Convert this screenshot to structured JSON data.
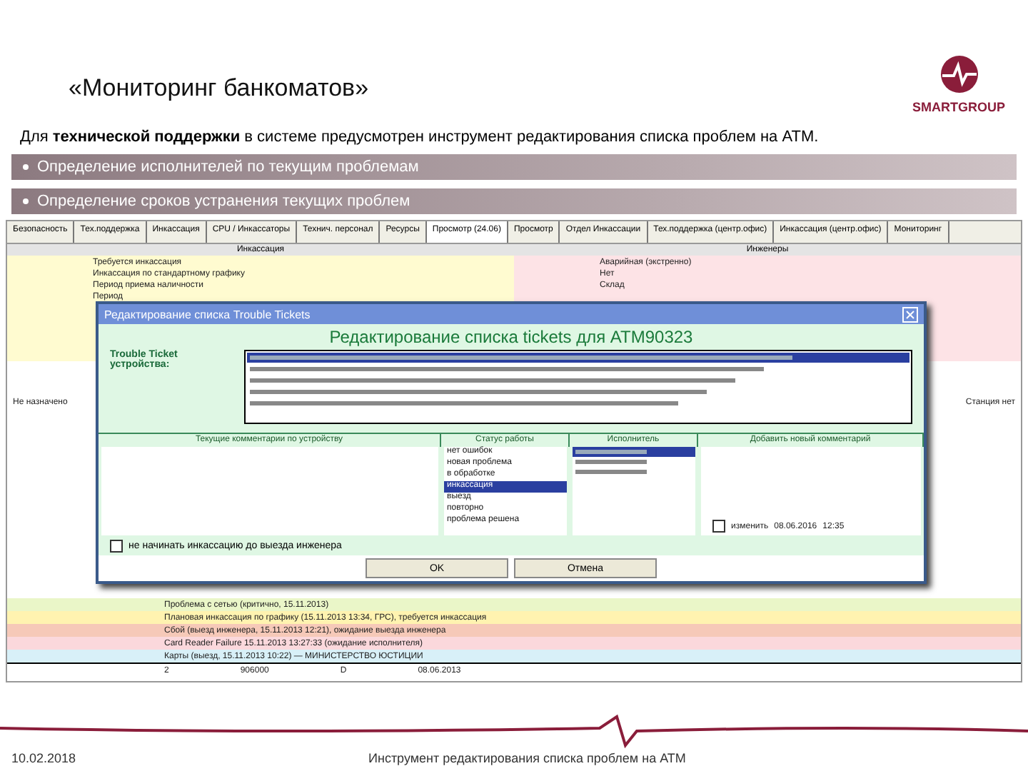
{
  "slide": {
    "title": "«Мониторинг банкоматов»",
    "logo_text": "SMARTGROUP",
    "intro": "Для **технической поддержки** в системе предусмотрен инструмент редактирования списка проблем на ATM.",
    "bullets": [
      "Определение исполнителей по текущим проблемам",
      "Определение сроков устранения текущих проблем"
    ],
    "date": "10.02.2018",
    "footer": "Инструмент редактирования списка проблем на ATM"
  },
  "app": {
    "tabs": [
      {
        "label": "Безопасность",
        "selected": false
      },
      {
        "label": "Тех.поддержка",
        "selected": false
      },
      {
        "label": "Инкассация",
        "selected": false
      },
      {
        "label": "CPU / Инкассаторы",
        "selected": false
      },
      {
        "label": "Технич. персонал",
        "selected": false
      },
      {
        "label": "Ресурсы",
        "selected": false
      },
      {
        "label": "Просмотр (24.06)",
        "selected": true
      },
      {
        "label": "Просмотр",
        "selected": false
      },
      {
        "label": "Отдел Инкассации",
        "selected": false
      },
      {
        "label": "Тех.поддержка (центр.офис)",
        "selected": false
      },
      {
        "label": "Инкассация (центр.офис)",
        "selected": false
      },
      {
        "label": "Мониторинг",
        "selected": false
      }
    ],
    "groups": [
      "Инкассация",
      "Инженеры"
    ],
    "left_rows": [
      "Требуется инкассация",
      "Инкассация по стандартному графику",
      "Период приема наличности",
      "Период"
    ],
    "right_rows": [
      "Аварийная (экстренно)",
      "Нет",
      "Склад"
    ],
    "side_label": "Не назначено",
    "side_right": "Станция нет",
    "bottom_rows": [
      {
        "color": "#eaf6c8",
        "text": "Проблема с сетью (критично, 15.11.2013)"
      },
      {
        "color": "#fff3b0",
        "text": "Плановая инкассация по графику (15.11.2013 13:34, ГРС), требуется инкассация"
      },
      {
        "color": "#f6c9b8",
        "text": "Сбой (выезд инженера, 15.11.2013 12:21), ожидание выезда инженера"
      },
      {
        "color": "#fbd8dc",
        "text": "Card Reader Failure 15.11.2013 13:27:33 (ожидание исполнителя)"
      },
      {
        "color": "#d8f0f8",
        "text": "Карты (выезд, 15.11.2013 10:22) — МИНИСТЕРСТВО ЮСТИЦИИ"
      }
    ],
    "last_row": [
      "2",
      "906000",
      "D",
      "08.06.2013"
    ]
  },
  "dialog": {
    "title": "Редактирование списка Trouble Tickets",
    "heading": "Редактирование списка tickets для ATM90323",
    "tt_label": "Trouble Ticket устройства:",
    "tickets": [
      {
        "selected": true
      },
      {
        "selected": false
      },
      {
        "selected": false
      },
      {
        "selected": false
      },
      {
        "selected": false
      }
    ],
    "sections": [
      "Текущие комментарии по устройству",
      "Статус работы",
      "Исполнитель",
      "Добавить новый комментарий"
    ],
    "statuses": [
      {
        "label": "нет ошибок",
        "selected": false
      },
      {
        "label": "новая проблема",
        "selected": false
      },
      {
        "label": "в обработке",
        "selected": false
      },
      {
        "label": "инкассация",
        "selected": true
      },
      {
        "label": "выезд",
        "selected": false
      },
      {
        "label": "повторно",
        "selected": false
      },
      {
        "label": "проблема решена",
        "selected": false
      }
    ],
    "executors": [
      {
        "selected": true
      },
      {
        "selected": false
      },
      {
        "selected": false
      }
    ],
    "no_cash": {
      "label": "не начинать инкассацию до выезда инженера",
      "checked": false
    },
    "change": {
      "label": "изменить",
      "checked": false,
      "date": "08.06.2016",
      "time": "12:35"
    },
    "buttons": [
      "OK",
      "Отмена"
    ]
  }
}
